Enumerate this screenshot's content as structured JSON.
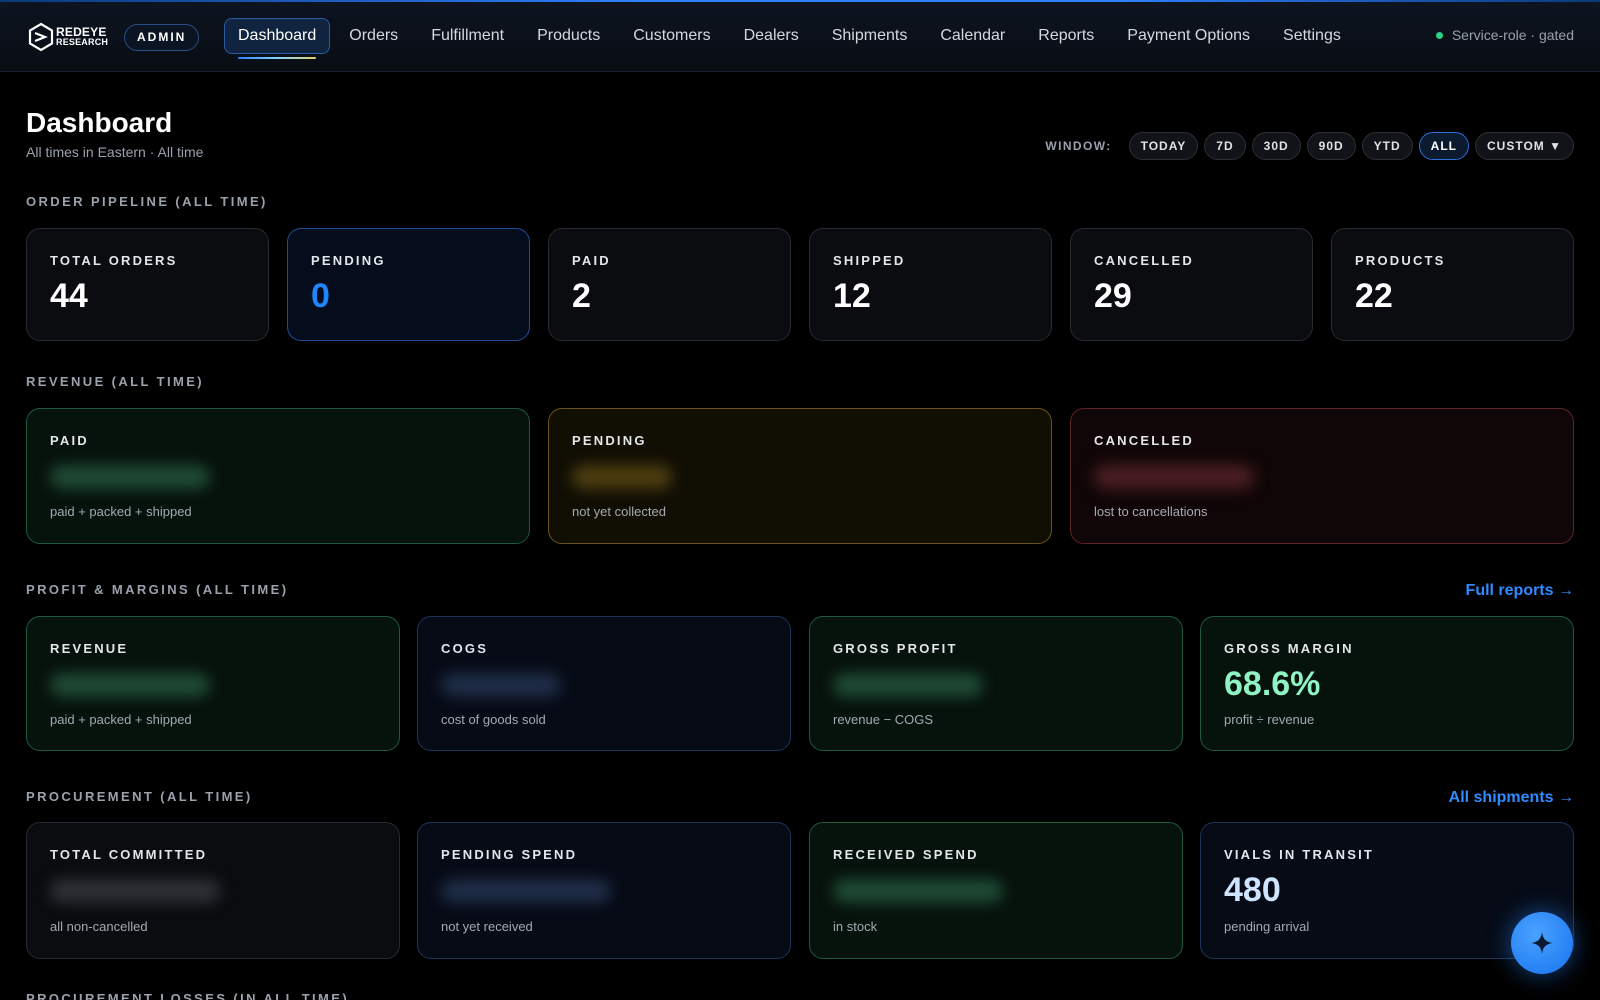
{
  "brand": {
    "line1": "REDEYE",
    "line2": "RESEARCH",
    "role_badge": "ADMIN"
  },
  "nav": {
    "items": [
      {
        "label": "Dashboard",
        "active": true
      },
      {
        "label": "Orders"
      },
      {
        "label": "Fulfillment"
      },
      {
        "label": "Products"
      },
      {
        "label": "Customers"
      },
      {
        "label": "Dealers"
      },
      {
        "label": "Shipments"
      },
      {
        "label": "Calendar"
      },
      {
        "label": "Reports"
      },
      {
        "label": "Payment Options"
      },
      {
        "label": "Settings"
      }
    ],
    "status": "Service-role · gated",
    "status_color": "#2ecf86"
  },
  "header": {
    "title": "Dashboard",
    "subtitle": "All times in Eastern · All time",
    "window_label": "WINDOW:",
    "window_options": [
      "TODAY",
      "7D",
      "30D",
      "90D",
      "YTD",
      "ALL",
      "CUSTOM ▼"
    ],
    "window_selected": "ALL"
  },
  "pipeline": {
    "label": "ORDER PIPELINE (ALL TIME)",
    "cards": [
      {
        "label": "TOTAL ORDERS",
        "value": "44"
      },
      {
        "label": "PENDING",
        "value": "0"
      },
      {
        "label": "PAID",
        "value": "2"
      },
      {
        "label": "SHIPPED",
        "value": "12"
      },
      {
        "label": "CANCELLED",
        "value": "29"
      },
      {
        "label": "PRODUCTS",
        "value": "22"
      }
    ]
  },
  "revenue": {
    "label": "REVENUE (ALL TIME)",
    "cards": [
      {
        "label": "PAID",
        "sub": "paid + packed + shipped"
      },
      {
        "label": "PENDING",
        "sub": "not yet collected"
      },
      {
        "label": "CANCELLED",
        "sub": "lost to cancellations"
      }
    ]
  },
  "profit": {
    "label": "PROFIT & MARGINS (ALL TIME)",
    "link": "Full reports →",
    "cards": [
      {
        "label": "REVENUE",
        "sub": "paid + packed + shipped"
      },
      {
        "label": "COGS",
        "sub": "cost of goods sold"
      },
      {
        "label": "GROSS PROFIT",
        "sub": "revenue − COGS"
      },
      {
        "label": "GROSS MARGIN",
        "value": "68.6%",
        "sub": "profit ÷ revenue"
      }
    ]
  },
  "procurement": {
    "label": "PROCUREMENT (ALL TIME)",
    "link": "All shipments →",
    "cards": [
      {
        "label": "TOTAL COMMITTED",
        "sub": "all non-cancelled"
      },
      {
        "label": "PENDING SPEND",
        "sub": "not yet received"
      },
      {
        "label": "RECEIVED SPEND",
        "sub": "in stock"
      },
      {
        "label": "VIALS IN TRANSIT",
        "value": "480",
        "sub": "pending arrival"
      }
    ]
  },
  "next_section_label": "PROCUREMENT LOSSES (IN ALL TIME)",
  "colors": {
    "accent": "#2f8bff",
    "pending_blue": "#1f86ff",
    "margin_mint": "#8ff3c4"
  }
}
